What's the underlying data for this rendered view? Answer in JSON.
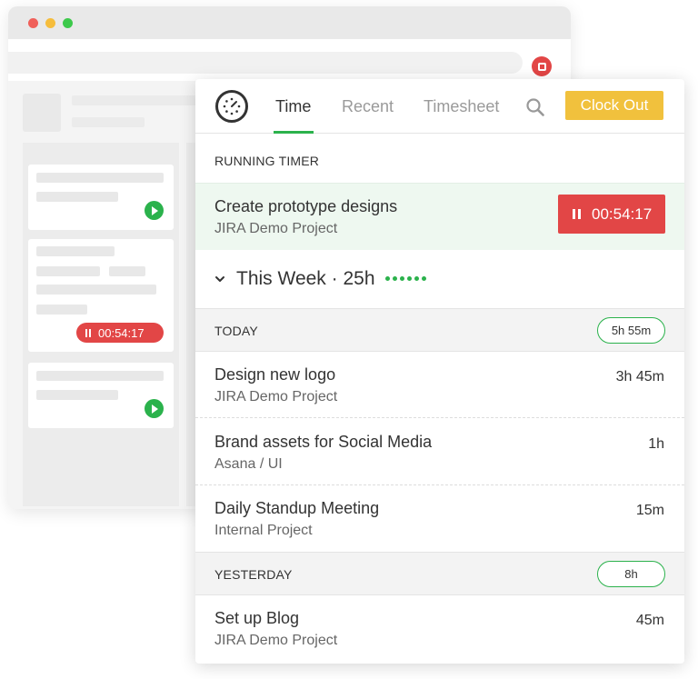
{
  "background_browser": {
    "timer_label": "00:54:17"
  },
  "panel": {
    "nav": {
      "tabs": [
        {
          "label": "Time",
          "active": true
        },
        {
          "label": "Recent",
          "active": false
        },
        {
          "label": "Timesheet",
          "active": false
        }
      ],
      "search_icon": "search-icon",
      "clock_out_label": "Clock Out"
    },
    "running": {
      "section_label": "RUNNING TIMER",
      "title": "Create prototype designs",
      "project": "JIRA Demo Project",
      "elapsed": "00:54:17"
    },
    "week": {
      "label": "This Week · 25h"
    },
    "days": [
      {
        "label": "TODAY",
        "total": "5h 55m",
        "entries": [
          {
            "title": "Design new logo",
            "project": "JIRA Demo Project",
            "duration": "3h 45m"
          },
          {
            "title": "Brand assets for Social Media",
            "project": "Asana / UI",
            "duration": "1h"
          },
          {
            "title": "Daily Standup Meeting",
            "project": "Internal Project",
            "duration": "15m"
          }
        ]
      },
      {
        "label": "YESTERDAY",
        "total": "8h",
        "entries": [
          {
            "title": "Set up Blog",
            "project": "JIRA Demo Project",
            "duration": "45m"
          }
        ]
      }
    ]
  },
  "colors": {
    "accent_green": "#2bb24c",
    "stop_red": "#e24646",
    "clock_out_yellow": "#f1c13d"
  }
}
